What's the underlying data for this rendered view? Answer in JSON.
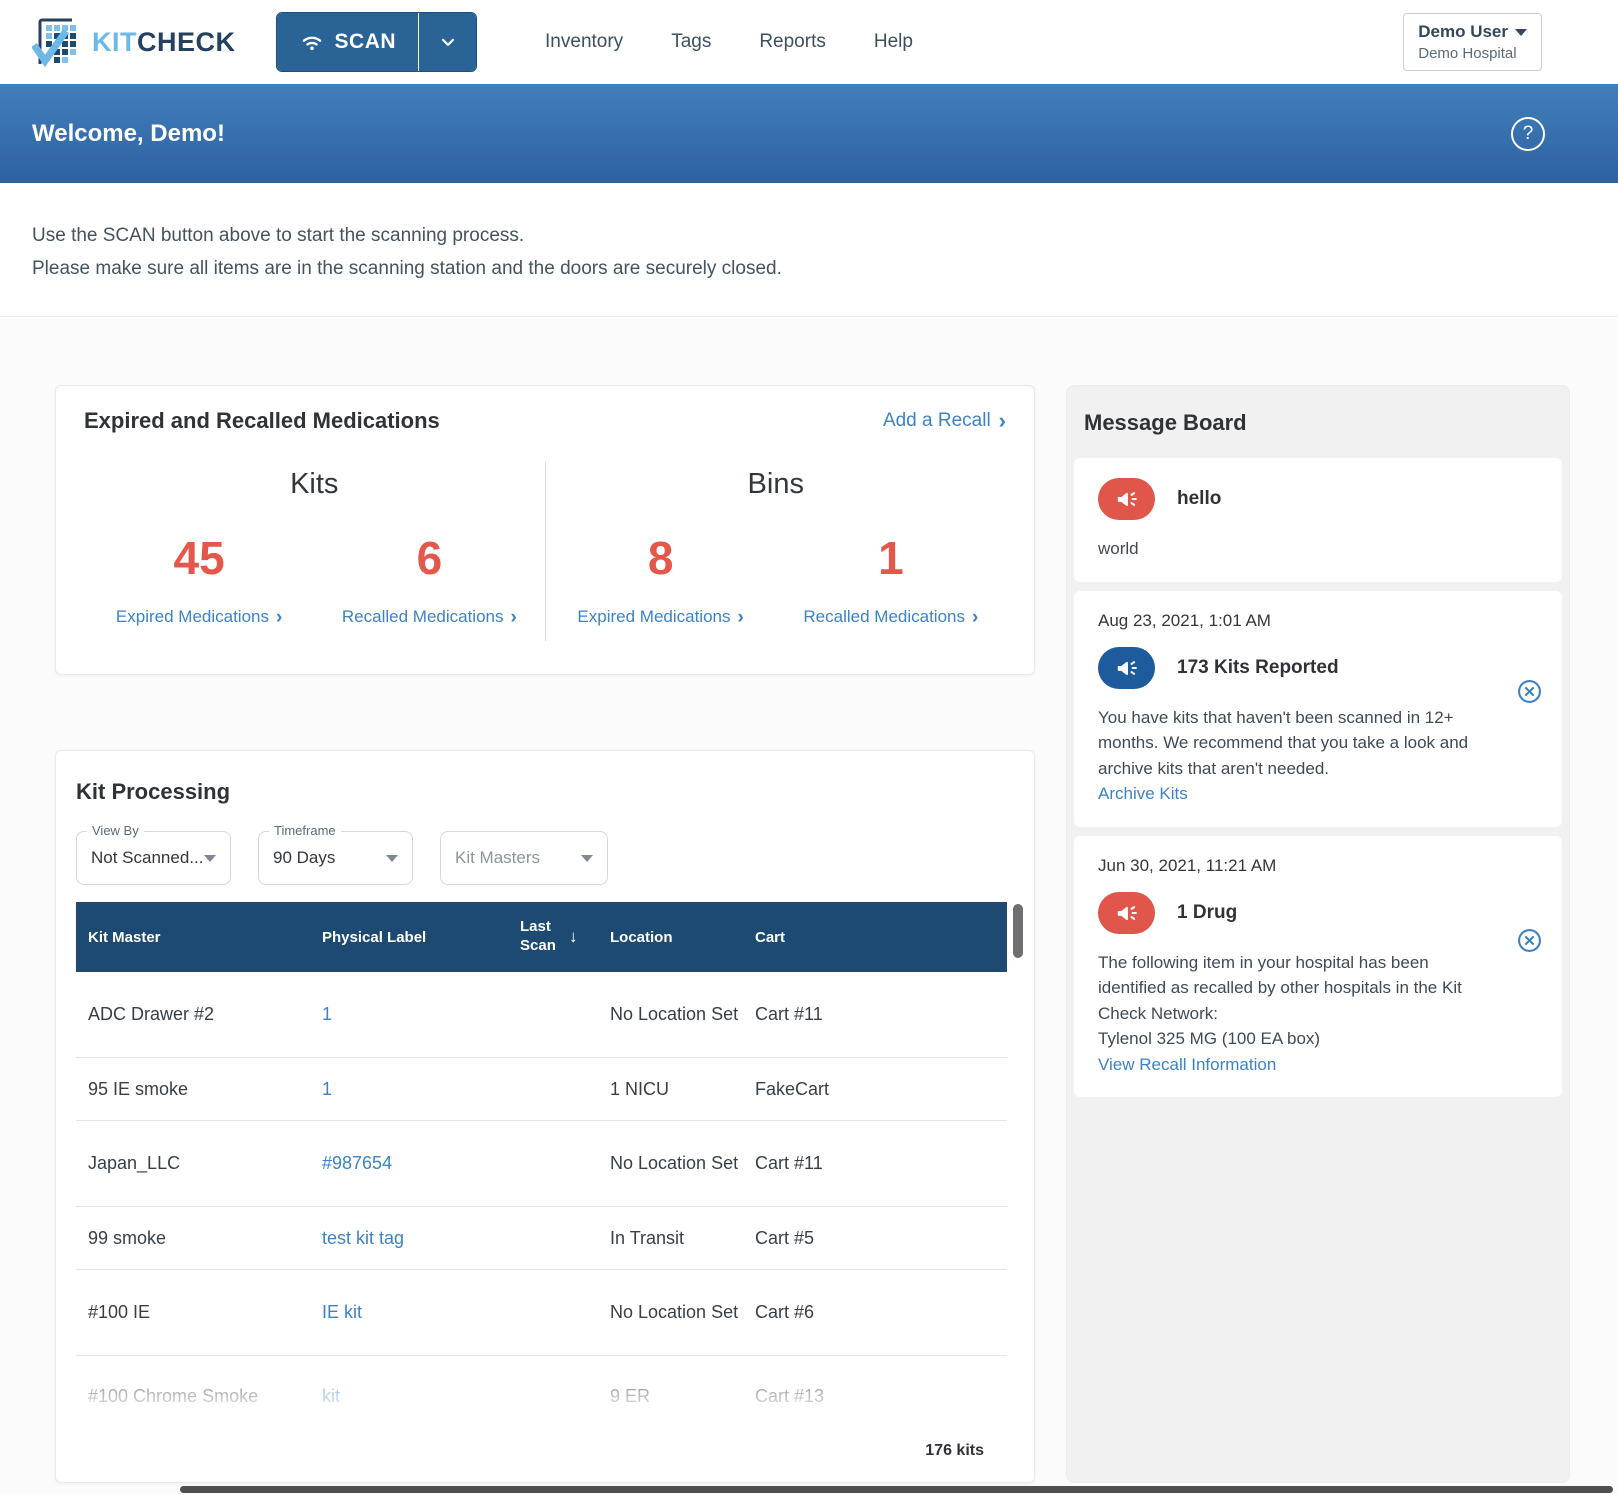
{
  "glyphs": {
    "chevron_right": "›",
    "sort_down": "↓",
    "help": "?"
  },
  "navbar": {
    "brand": {
      "kit": "KIT",
      "check": "CHECK"
    },
    "scan_label": "SCAN",
    "links": [
      {
        "label": "Inventory"
      },
      {
        "label": "Tags"
      },
      {
        "label": "Reports"
      },
      {
        "label": "Help"
      }
    ],
    "user": {
      "name": "Demo User",
      "org": "Demo Hospital"
    }
  },
  "banner": {
    "welcome": "Welcome, Demo!"
  },
  "instructions": {
    "line1": "Use the SCAN button above to start the scanning process.",
    "line2": "Please make sure all items are in the scanning station and the doors are securely closed."
  },
  "expired_card": {
    "title": "Expired and Recalled Medications",
    "add_recall_label": "Add a Recall",
    "groups": [
      {
        "heading": "Kits",
        "stats": [
          {
            "value": "45",
            "label": "Expired Medications"
          },
          {
            "value": "6",
            "label": "Recalled Medications"
          }
        ]
      },
      {
        "heading": "Bins",
        "stats": [
          {
            "value": "8",
            "label": "Expired Medications"
          },
          {
            "value": "1",
            "label": "Recalled Medications"
          }
        ]
      }
    ]
  },
  "kit_processing": {
    "title": "Kit Processing",
    "filters": [
      {
        "label": "View By",
        "value": "Not Scanned..."
      },
      {
        "label": "Timeframe",
        "value": "90 Days"
      },
      {
        "label": "",
        "value": "Kit Masters"
      }
    ],
    "columns": [
      "Kit Master",
      "Physical Label",
      "Last Scan",
      "Location",
      "Cart"
    ],
    "rows": [
      {
        "kit_master": "ADC Drawer #2",
        "physical_label": "1",
        "last_scan": "",
        "location": "No Location Set",
        "cart": "Cart #11"
      },
      {
        "kit_master": "95 IE smoke",
        "physical_label": "1",
        "last_scan": "",
        "location": "1 NICU",
        "cart": "FakeCart"
      },
      {
        "kit_master": "Japan_LLC",
        "physical_label": "#987654",
        "last_scan": "",
        "location": "No Location Set",
        "cart": "Cart #11"
      },
      {
        "kit_master": "99 smoke",
        "physical_label": "test kit tag",
        "last_scan": "",
        "location": "In Transit",
        "cart": "Cart #5"
      },
      {
        "kit_master": "#100 IE",
        "physical_label": "IE kit",
        "last_scan": "",
        "location": "No Location Set",
        "cart": "Cart #6"
      },
      {
        "kit_master": "#100 Chrome Smoke",
        "physical_label": "kit",
        "last_scan": "",
        "location": "9 ER",
        "cart": "Cart #13"
      }
    ],
    "footer_count": "176 kits"
  },
  "message_board": {
    "title": "Message Board",
    "messages": [
      {
        "title": "hello",
        "body": "world"
      },
      {
        "date": "Aug 23, 2021, 1:01 AM",
        "title": "173 Kits Reported",
        "body": "You have kits that haven't been scanned in 12+ months. We recommend that you take a look and archive kits that aren't needed.",
        "link": "Archive Kits"
      },
      {
        "date": "Jun 30, 2021, 11:21 AM",
        "title": "1 Drug",
        "body": "The following item in your hospital has been identified as recalled by other hospitals in the Kit Check Network:",
        "body2": "Tylenol 325 MG (100 EA box)",
        "link": "View Recall Information"
      }
    ]
  },
  "colors": {
    "accent_red": "#e4574b",
    "link_blue": "#3d82c4",
    "table_header_navy": "#1d4a73",
    "scan_blue": "#2a6395",
    "banner_top": "#417fbc",
    "banner_bottom": "#2e61a0",
    "icon_red": "#e0564a",
    "icon_blue": "#1e5b9c"
  }
}
